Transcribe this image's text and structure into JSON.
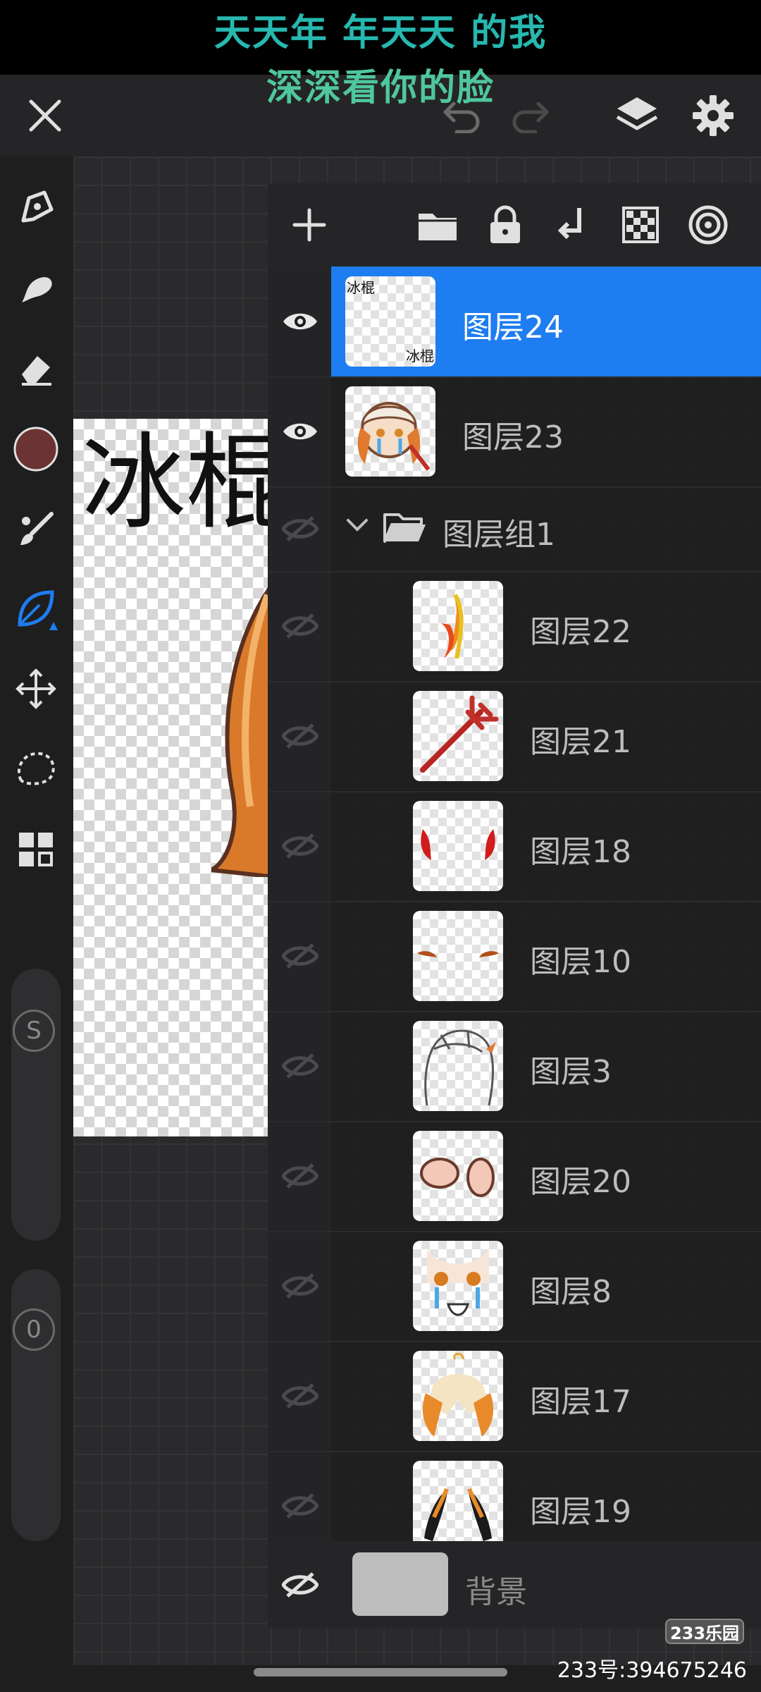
{
  "caption": {
    "line1": "天天年 年天天 的我",
    "line2": "深深看你的脸"
  },
  "topbar": {
    "close_icon": "close-icon",
    "undo_icon": "undo-icon",
    "redo_icon": "redo-icon",
    "layers_icon": "layers-icon",
    "settings_icon": "gear-icon"
  },
  "tools": {
    "items": [
      "pen-icon",
      "smudge-icon",
      "eraser-icon",
      "color-swatch",
      "brush-icon",
      "leaf-brush-icon",
      "move-icon",
      "lasso-icon",
      "grid-icon"
    ],
    "current_color": "#6b3333",
    "active_tool_color": "#1e7df0",
    "size_slider_label": "S",
    "opacity_slider_label": "0"
  },
  "canvas": {
    "art_text": "冰棍"
  },
  "layers": {
    "toolbar_icons": [
      "add-icon",
      "folder-icon",
      "lock-icon",
      "merge-down-icon",
      "checker-icon",
      "target-icon"
    ],
    "rows": [
      {
        "name": "图层24",
        "visible": true,
        "selected": true,
        "thumb_label_top": "冰棍",
        "thumb_label_bottom": "冰棍"
      },
      {
        "name": "图层23",
        "visible": true
      },
      {
        "name": "图层组1",
        "group": true
      },
      {
        "name": "图层22"
      },
      {
        "name": "图层21"
      },
      {
        "name": "图层18"
      },
      {
        "name": "图层10"
      },
      {
        "name": "图层3"
      },
      {
        "name": "图层20"
      },
      {
        "name": "图层8"
      },
      {
        "name": "图层17"
      },
      {
        "name": "图层19"
      }
    ],
    "background": {
      "name": "背景"
    }
  },
  "watermark": {
    "logo": "233乐园",
    "id": "233号:394675246"
  }
}
